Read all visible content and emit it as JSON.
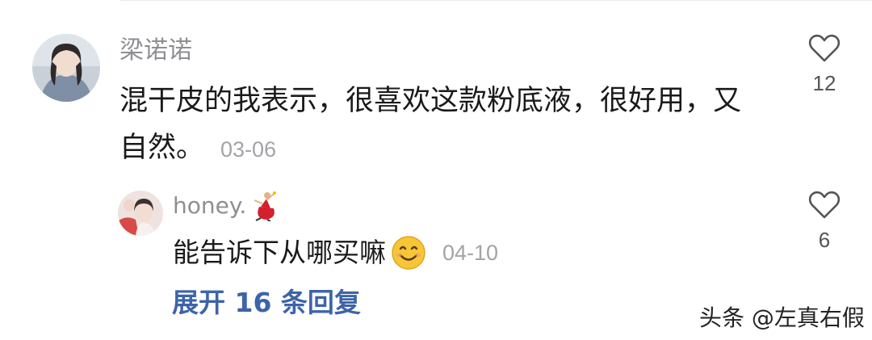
{
  "comment": {
    "username": "梁诺诺",
    "text": "混干皮的我表示，很喜欢这款粉底液，很好用，又自然。",
    "date": "03-06",
    "likes": "12",
    "avatar_icon": "user-avatar-photo"
  },
  "reply": {
    "username": "honey.",
    "username_emoji": "dancer-emoji",
    "text": "能告诉下从哪买嘛",
    "emoji": "smiling-face-emoji",
    "date": "04-10",
    "likes": "6",
    "avatar_icon": "user-avatar-photo"
  },
  "expand_replies_label": "展开 16 条回复",
  "watermark": "头条 @左真右假",
  "colors": {
    "username": "#8e8e93",
    "text": "#1a1a1a",
    "date": "#a3a3a8",
    "link": "#3d64a8",
    "icon": "#555555"
  }
}
